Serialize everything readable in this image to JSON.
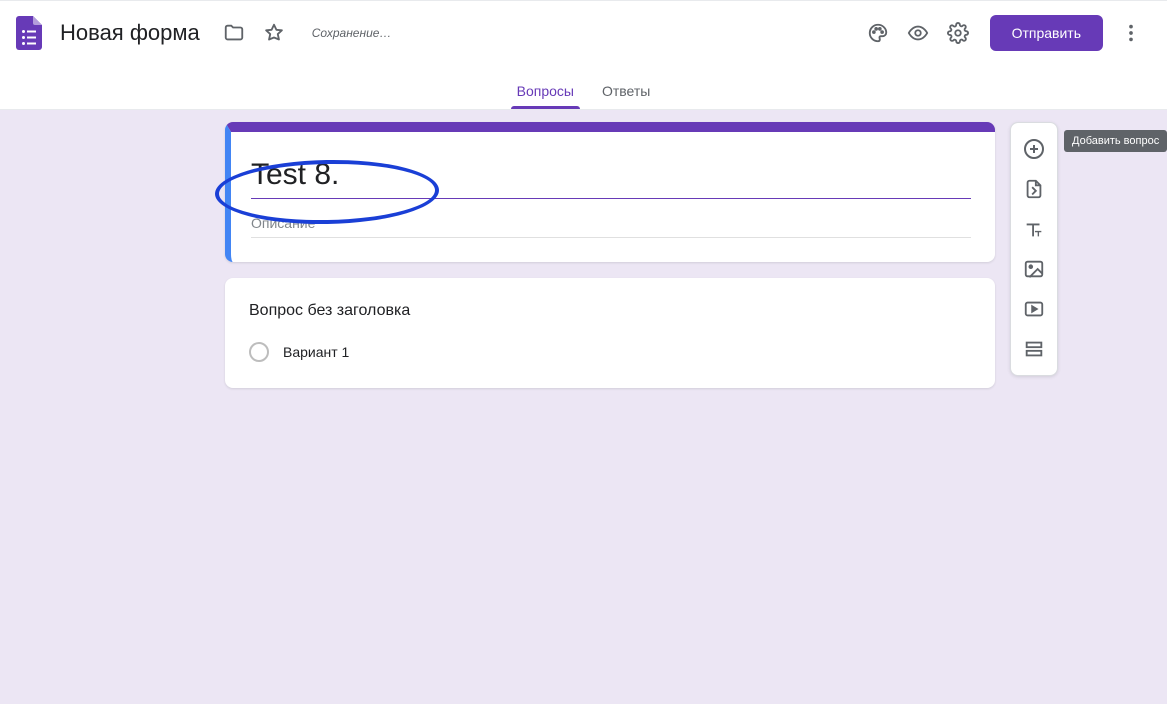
{
  "header": {
    "doc_title": "Новая форма",
    "save_state": "Сохранение…",
    "send_button": "Отправить"
  },
  "tabs": {
    "questions": "Вопросы",
    "responses": "Ответы"
  },
  "form": {
    "title_value": "Test 8.",
    "description_placeholder": "Описание"
  },
  "question": {
    "untitled_label": "Вопрос без заголовка",
    "option1_label": "Вариант 1"
  },
  "side_toolbar": {
    "add_question_tooltip": "Добавить вопрос"
  },
  "icons": {
    "folder": "folder-icon",
    "star": "star-icon",
    "palette": "palette-icon",
    "preview": "eye-icon",
    "settings": "gear-icon",
    "more": "more-vert-icon",
    "add": "add-circle-icon",
    "import": "import-file-icon",
    "text": "text-title-icon",
    "image": "image-icon",
    "video": "video-icon",
    "section": "section-icon"
  },
  "colors": {
    "brand": "#673ab7",
    "active_accent": "#4285f4",
    "canvas_bg": "#ece6f4"
  }
}
